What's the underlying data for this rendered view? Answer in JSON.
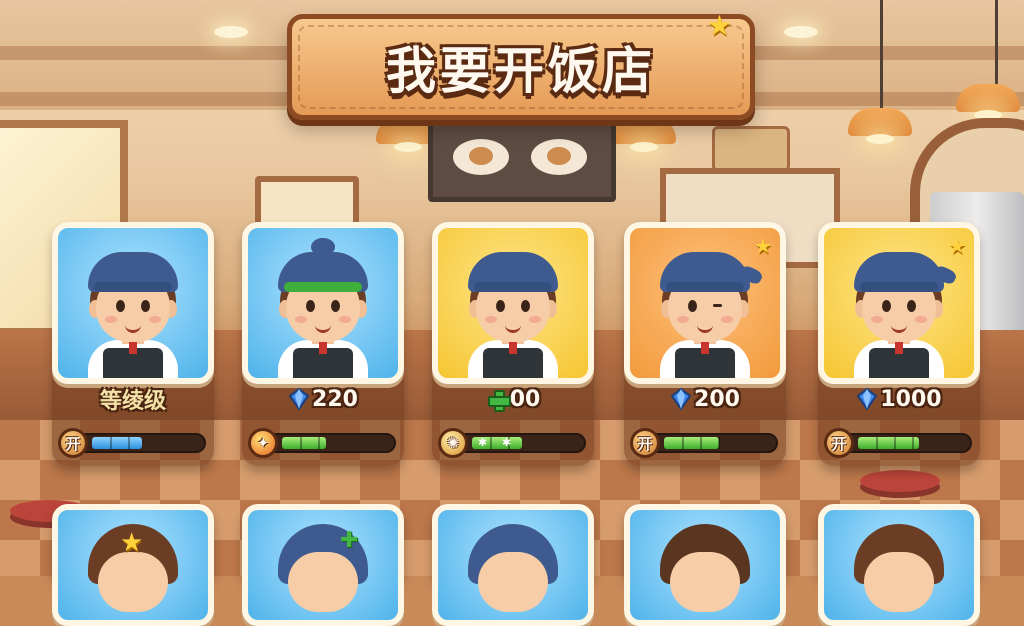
{
  "title": "我要开饭店",
  "cards": [
    {
      "stat_text": "等绫级",
      "stat_icon": "none",
      "badge_glyph": "开",
      "badge_icon": "open-badge-icon",
      "bar_color": "blue",
      "bar_level": 0.45
    },
    {
      "stat_text": "220",
      "stat_icon": "gem-icon",
      "badge_glyph": "",
      "badge_icon": "flame-badge-icon",
      "bar_color": "green",
      "bar_level": 0.4
    },
    {
      "stat_text": "00",
      "stat_icon": "cross-icon",
      "badge_glyph": "",
      "badge_icon": "burst-badge-icon",
      "bar_color": "green",
      "bar_level": 0.45
    },
    {
      "stat_text": "200",
      "stat_icon": "gem-icon",
      "badge_glyph": "开",
      "badge_icon": "open-badge-icon",
      "bar_color": "green",
      "bar_level": 0.5
    },
    {
      "stat_text": "1000",
      "stat_icon": "gem-icon",
      "badge_glyph": "开",
      "badge_icon": "open-badge-icon",
      "bar_color": "green",
      "bar_level": 0.55
    }
  ],
  "colors": {
    "banner": "#e59a55",
    "banner_border": "#8d4b23",
    "gem": "#3f86e8",
    "cross": "#42b843"
  }
}
